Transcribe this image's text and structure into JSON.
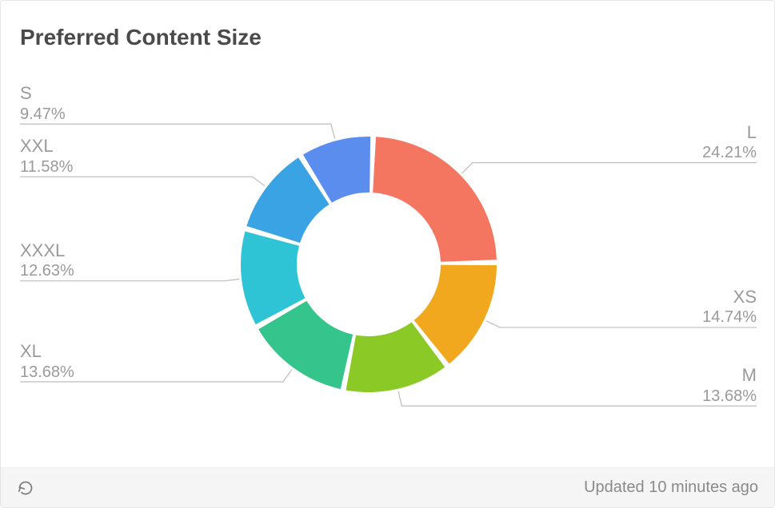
{
  "title": "Preferred Content Size",
  "footer": {
    "updated_label": "Updated 10 minutes ago"
  },
  "chart_data": {
    "type": "pie",
    "title": "Preferred Content Size",
    "series": [
      {
        "name": "L",
        "value": 24.21,
        "label": "24.21%",
        "color": "#f47560"
      },
      {
        "name": "XS",
        "value": 14.74,
        "label": "14.74%",
        "color": "#f1a81e"
      },
      {
        "name": "M",
        "value": 13.68,
        "label": "13.68%",
        "color": "#8ac926"
      },
      {
        "name": "XL",
        "value": 13.68,
        "label": "13.68%",
        "color": "#34c48c"
      },
      {
        "name": "XXXL",
        "value": 12.63,
        "label": "12.63%",
        "color": "#2ec4d6"
      },
      {
        "name": "XXL",
        "value": 11.58,
        "label": "11.58%",
        "color": "#3aa3e3"
      },
      {
        "name": "S",
        "value": 9.47,
        "label": "9.47%",
        "color": "#5b8def"
      }
    ]
  }
}
